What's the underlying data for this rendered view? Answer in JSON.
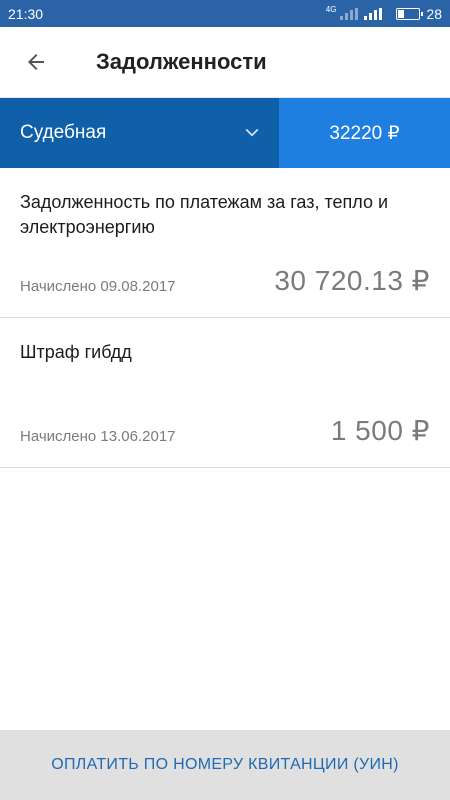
{
  "status_bar": {
    "time": "21:30",
    "network": "4G",
    "battery": "28",
    "icons": [
      "signal-4g-icon",
      "signal-icon",
      "battery-icon"
    ]
  },
  "header": {
    "back_icon": "arrow-left-icon",
    "title": "Задолженности"
  },
  "filter": {
    "selected": "Судебная",
    "dropdown_icon": "chevron-down-icon",
    "total": "32220 ₽"
  },
  "debts": [
    {
      "title": "Задолженность по платежам за газ, тепло и электроэнергию",
      "date": "Начислено 09.08.2017",
      "amount": "30 720.13 ₽"
    },
    {
      "title": "Штраф гибдд",
      "date": "Начислено 13.06.2017",
      "amount": "1 500 ₽"
    }
  ],
  "footer": {
    "pay_button": "ОПЛАТИТЬ ПО НОМЕРУ КВИТАНЦИИ (УИН)"
  },
  "colors": {
    "status_bar": "#2b64a6",
    "filter_select": "#0f5fa9",
    "filter_total": "#1f7fe0",
    "pay_text": "#1f6ab3"
  }
}
